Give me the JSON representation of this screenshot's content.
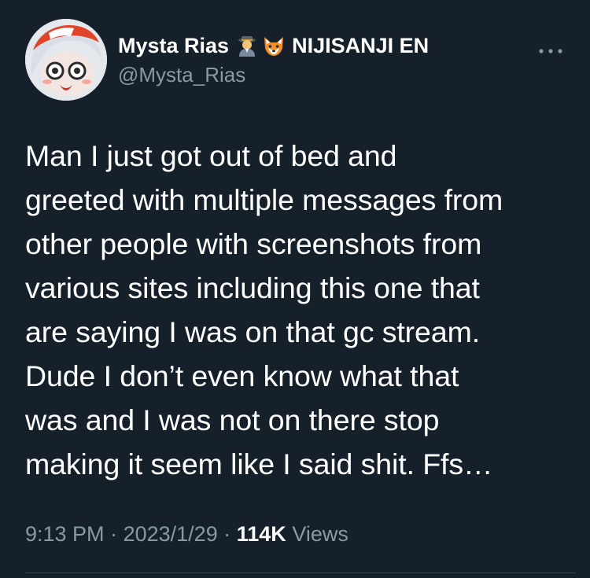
{
  "tweet": {
    "author": {
      "display_name": "Mysta Rias",
      "badge_emojis": [
        "detective-emoji",
        "fox-emoji"
      ],
      "affiliation": "NIJISANJI EN",
      "handle": "@Mysta_Rias"
    },
    "more_icon": "more-horizontal-icon",
    "text_lines": [
      "Man I just got out of bed and",
      "greeted with multiple messages from",
      "other people with screenshots from",
      "various sites including this one that",
      "are saying I was on that gc stream.",
      "Dude I don’t even know what that",
      "was and I was not on there stop",
      "making it seem like I said shit. Ffs…"
    ],
    "meta": {
      "time": "9:13 PM",
      "separator": "·",
      "date": "2023/1/29",
      "views_count": "114K",
      "views_label": "Views"
    }
  },
  "colors": {
    "background": "#15202b",
    "text_primary": "#ffffff",
    "text_secondary": "#8b98a5",
    "divider": "#38444d"
  }
}
